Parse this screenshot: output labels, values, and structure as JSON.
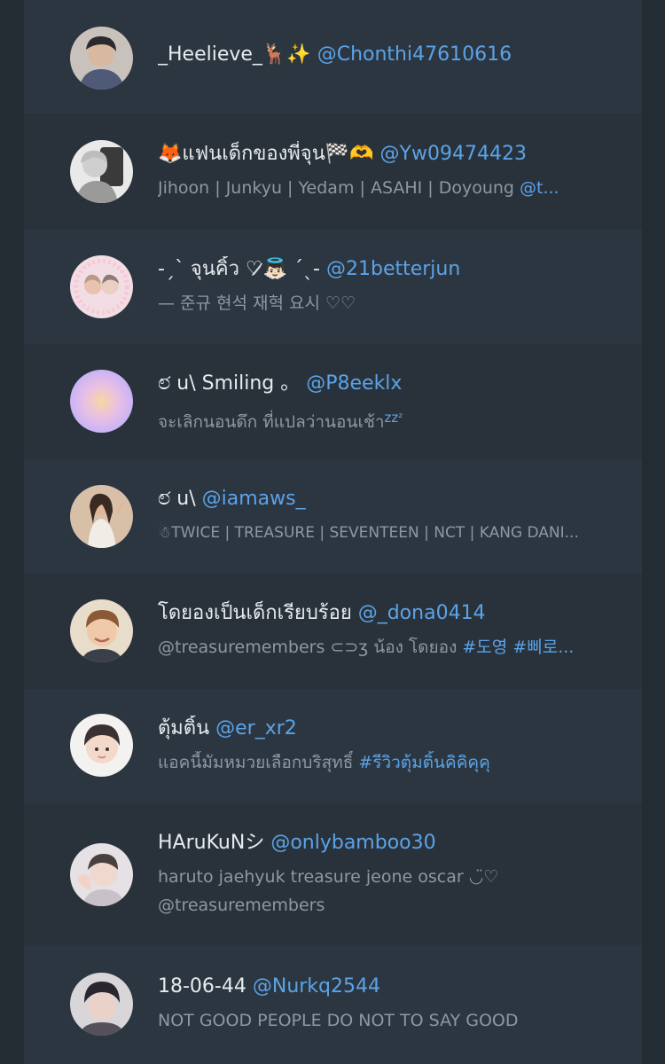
{
  "accounts": [
    {
      "name": "_Heelieve_🦌✨",
      "handle": "@Chonthi47610616",
      "avatar_icon": "profile-photo-dark-hair"
    },
    {
      "name": "🦊แฟนเด็กของพี่จุน🏁🫶",
      "handle": "@Yw09474423",
      "bio_text": "Jihoon | Junkyu | Yedam | ASAHI | Doyoung ",
      "bio_link": "@t...",
      "avatar_icon": "profile-photo-mirror-selfie"
    },
    {
      "name": "-ˏˋ จุนคิ้ว ♡̷👼🏻 ˊˎ-",
      "handle": "@21betterjun",
      "bio_text": "— 준규 현석 재혁 요시 ♡♡",
      "avatar_icon": "profile-photo-pink-frame"
    },
    {
      "name": "ಲ᷄ u\\ Smiling 。",
      "handle": "@P8eeklx",
      "bio_text": "จะเลิกนอนดึก ที่แปลว่านอนเช้า",
      "bio_suffix": "zzᶻ",
      "avatar_icon": "gradient-orb-avatar"
    },
    {
      "name": "ಲ᷄ u\\",
      "handle": "@iamaws_",
      "bio_text": "☃TWICE | TREASURE | SEVENTEEN | NCT | KANG DANI...",
      "avatar_icon": "profile-photo-girl-posing"
    },
    {
      "name": "โดยองเป็นเด็กเรียบร้อย",
      "handle": "@_dona0414",
      "bio_text": "@treasuremembers ⊂⊃ʒ น้อง โดยอง ",
      "bio_link": "#도영 #삐로...",
      "avatar_icon": "profile-photo-smiling-boy"
    },
    {
      "name": "ตุ้มติ้น",
      "handle": "@er_xr2",
      "bio_text": "แอคนี้มัมหมวยเลือกบริสุทธิ์ ",
      "bio_link": "#รีวิวตุ้มติ้นคิคิคุคุ",
      "avatar_icon": "profile-photo-child"
    },
    {
      "name": "HAruKuNシ",
      "handle": "@onlybamboo30",
      "bio_text": "haruto jaehyuk treasure jeone oscar ◡̈♡",
      "bio_line2": "@treasuremembers",
      "avatar_icon": "profile-photo-hand-pose"
    },
    {
      "name": "18-06-44",
      "handle": "@Nurkq2544",
      "bio_text": "NOT GOOD PEOPLE DO NOT TO SAY GOOD",
      "avatar_icon": "profile-photo-portrait"
    }
  ]
}
